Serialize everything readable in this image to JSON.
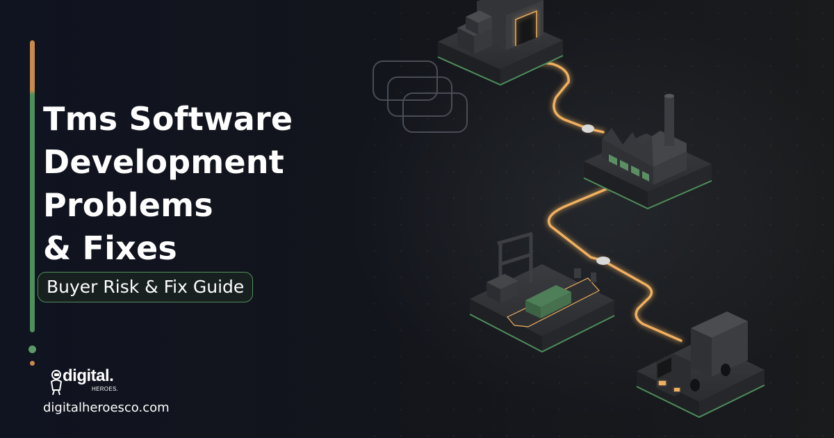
{
  "headline": {
    "lines": [
      "Tms Software",
      "Development",
      "Problems",
      "& Fixes"
    ]
  },
  "badge": {
    "label": "Buyer Risk & Fix Guide"
  },
  "brand": {
    "logo_word": "digital.",
    "logo_sub": "HEROES.",
    "url": "digitalheroesco.com"
  },
  "illustration": {
    "icons": [
      "warehouse-icon",
      "factory-icon",
      "cargo-ship-icon",
      "delivery-truck-icon"
    ]
  },
  "colors": {
    "background": "#101218",
    "accent_orange": "#c98a4b",
    "accent_green": "#4f8f5c",
    "route_glow": "#f0b060",
    "text": "#ffffff"
  }
}
